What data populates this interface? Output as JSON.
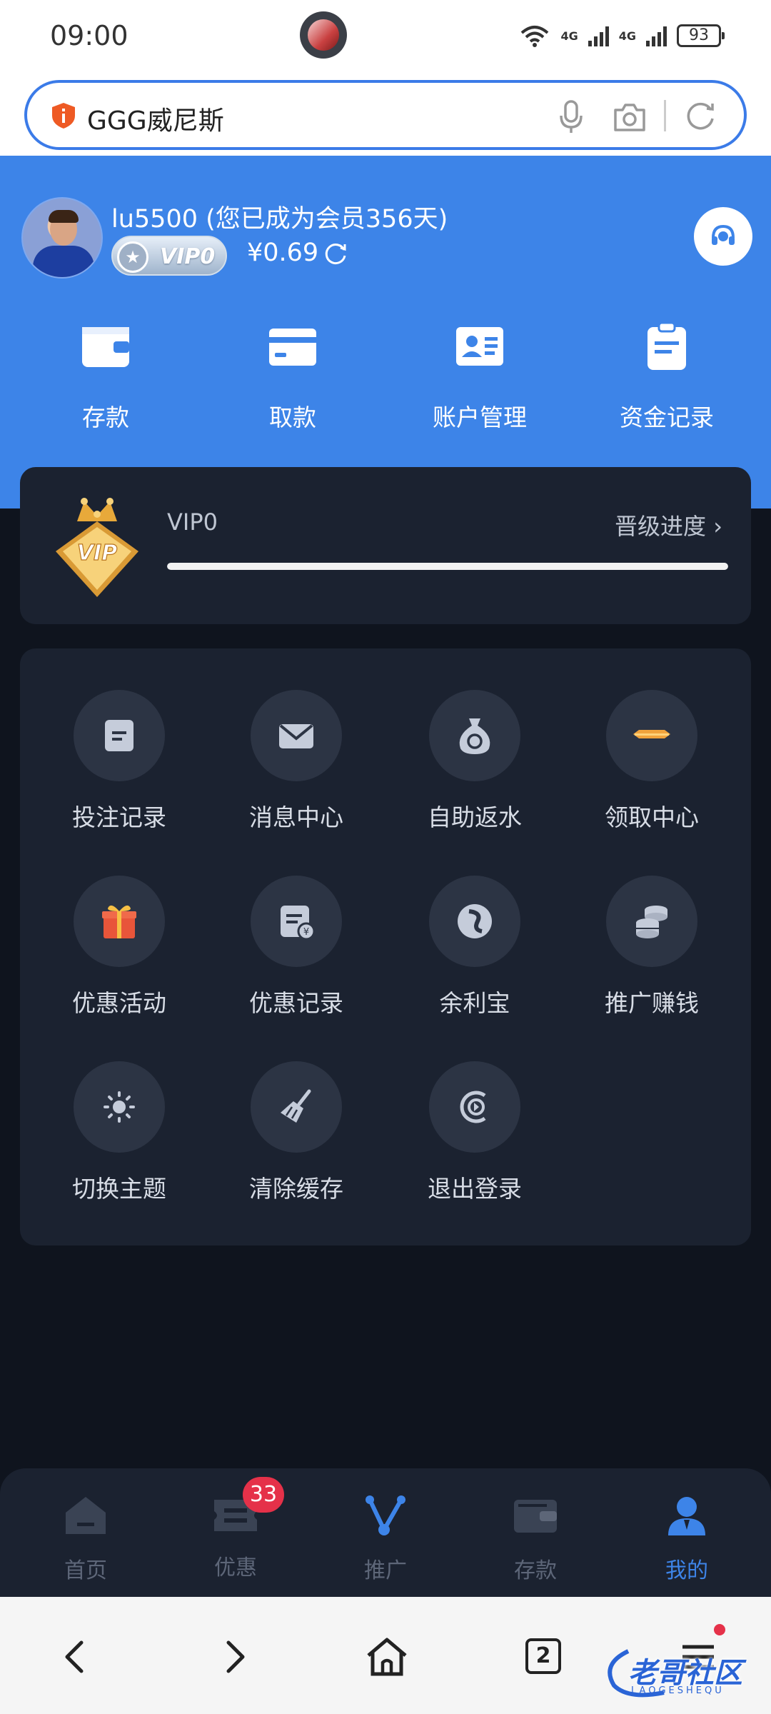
{
  "status_bar": {
    "time": "09:00",
    "battery": "93",
    "network": [
      "4G",
      "4G"
    ]
  },
  "search": {
    "query": "GGG威尼斯"
  },
  "user": {
    "name": "lu5500",
    "member_text": "(您已成为会员356天)",
    "vip_label": "VIP0",
    "balance": "¥0.69"
  },
  "quick_actions": [
    {
      "label": "存款",
      "icon": "wallet-icon"
    },
    {
      "label": "取款",
      "icon": "card-icon"
    },
    {
      "label": "账户管理",
      "icon": "id-card-icon"
    },
    {
      "label": "资金记录",
      "icon": "clipboard-icon"
    }
  ],
  "vip_card": {
    "level": "VIP0",
    "progress_label": "晋级进度",
    "progress_fraction": 1.0
  },
  "menu": [
    {
      "label": "投注记录",
      "icon": "document-icon"
    },
    {
      "label": "消息中心",
      "icon": "mail-icon"
    },
    {
      "label": "自助返水",
      "icon": "money-bag-icon"
    },
    {
      "label": "领取中心",
      "icon": "gold-bar-icon"
    },
    {
      "label": "优惠活动",
      "icon": "gift-icon"
    },
    {
      "label": "优惠记录",
      "icon": "coupon-record-icon"
    },
    {
      "label": "余利宝",
      "icon": "yulibao-icon"
    },
    {
      "label": "推广赚钱",
      "icon": "coins-icon"
    },
    {
      "label": "切换主题",
      "icon": "sun-icon"
    },
    {
      "label": "清除缓存",
      "icon": "broom-icon"
    },
    {
      "label": "退出登录",
      "icon": "logout-icon"
    }
  ],
  "tabs": [
    {
      "label": "首页",
      "icon": "home-icon",
      "active": false
    },
    {
      "label": "优惠",
      "icon": "ticket-icon",
      "active": false,
      "badge": "33"
    },
    {
      "label": "推广",
      "icon": "share-icon",
      "active": false
    },
    {
      "label": "存款",
      "icon": "wallet-icon",
      "active": false
    },
    {
      "label": "我的",
      "icon": "person-icon",
      "active": true
    }
  ],
  "browser_nav": {
    "tab_count": "2"
  },
  "watermark": {
    "text": "老哥社区",
    "sub": "LAOGESHEQU"
  },
  "colors": {
    "brand_blue": "#3d84e8",
    "panel": "#1b2230",
    "background": "#0f141e",
    "badge_red": "#e53149"
  }
}
